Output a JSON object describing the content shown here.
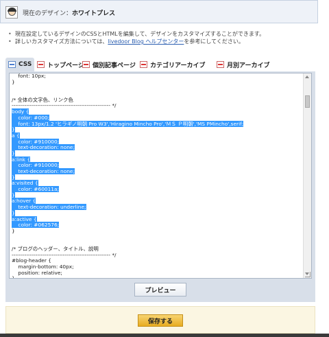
{
  "design_header": {
    "prefix": "現在のデザイン：",
    "name": "ホワイトプレス"
  },
  "notes": [
    "現在設定しているデザインのCSSとHTMLを編集して、デザインをカスタマイズすることができます。",
    "詳しいカスタマイズ方法については、",
    "livedoor Blog ヘルプセンター",
    "を参考にしてください。"
  ],
  "tabs": [
    {
      "label": "CSS",
      "icon": "css-file-icon"
    },
    {
      "label": "トップページ",
      "icon": "html-file-icon"
    },
    {
      "label": "個別記事ページ",
      "icon": "html-file-icon"
    },
    {
      "label": "カテゴリアーカイブ",
      "icon": "html-file-icon"
    },
    {
      "label": "月別アーカイブ",
      "icon": "html-file-icon"
    }
  ],
  "code_lines": [
    "    font: 10px;",
    "}",
    "",
    "",
    "/* 全体の文字色、リンク色",
    "------------------------------------------------------ */",
    "body {",
    "    color: #000;",
    "    font: 13px/1.2 'ヒラギノ明朝 Pro W3','Hiragino Mincho Pro','ＭＳ Ｐ明朝','MS PMincho',serif;",
    "}",
    "a {",
    "    color: #910000;",
    "    text-decoration: none;",
    "}",
    "a:link {",
    "    color: #910000;",
    "    text-decoration: none;",
    "}",
    "a:visited {",
    "    color: #60011a;",
    "}",
    "a:hover {",
    "    text-decoration: underline;",
    "}",
    "a:active {",
    "    color: #062576;",
    "}",
    "",
    "",
    "/* ブログのヘッダー、タイトル、説明",
    "------------------------------------------------------ */",
    "#blog-header {",
    "    margin-bottom: 40px;",
    "    position: relative;",
    "}"
  ],
  "selected_range": [
    6,
    25
  ],
  "buttons": {
    "preview": "プレビュー",
    "save": "保存する"
  },
  "colors": {
    "panel_bg": "#d8dfe9",
    "selection": "#3399ff",
    "save_button": "#e8ac22"
  }
}
